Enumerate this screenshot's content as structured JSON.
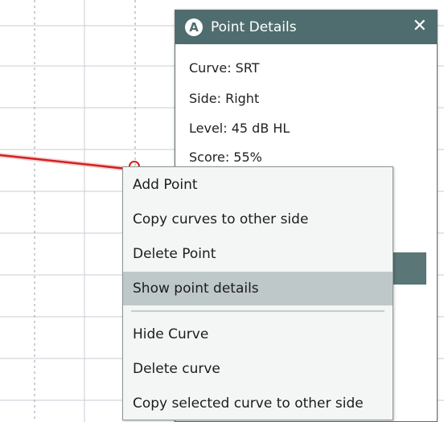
{
  "details_panel": {
    "badge": "A",
    "title": "Point Details",
    "close_glyph": "✕",
    "rows": [
      "Curve: SRT",
      "Side: Right",
      "Level: 45 dB HL",
      "Score: 55%"
    ]
  },
  "context_menu": {
    "items": [
      "Add Point",
      "Copy curves to other side",
      "Delete Point",
      "Show point details",
      "Hide Curve",
      "Delete curve",
      "Copy selected curve to other side"
    ],
    "highlighted": "Show point details"
  },
  "colors": {
    "header": "#4f6d6e",
    "curve": "#d32020",
    "grid": "#c8cdd6",
    "menu_hover": "#bfc8c8"
  },
  "icons": [
    "close-icon",
    "point-marker-icon"
  ]
}
